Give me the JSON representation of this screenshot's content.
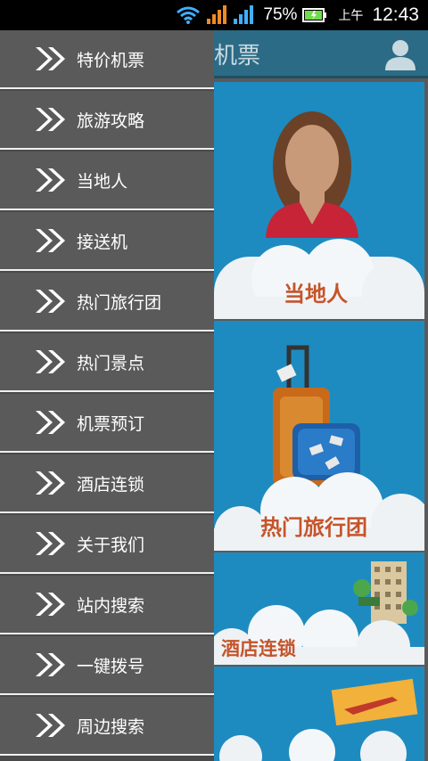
{
  "status_bar": {
    "battery_percent": "75%",
    "ampm": "上午",
    "time": "12:43",
    "icons": [
      "wifi-icon",
      "signal-icon",
      "signal-icon",
      "battery-icon"
    ]
  },
  "header": {
    "title": "机票",
    "user_icon": "user-icon"
  },
  "tiles": [
    {
      "label": "当地人",
      "image": "woman-avatar"
    },
    {
      "label": "热门旅行团",
      "image": "suitcases"
    },
    {
      "label": "酒店连锁",
      "image": "hotel"
    },
    {
      "label": "",
      "image": "airplane-ticket"
    }
  ],
  "drawer": {
    "items": [
      {
        "label": "特价机票"
      },
      {
        "label": "旅游攻略"
      },
      {
        "label": "当地人"
      },
      {
        "label": "接送机"
      },
      {
        "label": "热门旅行团"
      },
      {
        "label": "热门景点"
      },
      {
        "label": "机票预订"
      },
      {
        "label": "酒店连锁"
      },
      {
        "label": "关于我们"
      },
      {
        "label": "站内搜索"
      },
      {
        "label": "一键拨号"
      },
      {
        "label": "周边搜索"
      }
    ],
    "item_icon": "double-chevron-right-icon"
  },
  "colors": {
    "drawer_item_bg": "#5a5a5a",
    "header_bg": "#2b6b86",
    "tile_bg": "#1e8bc0",
    "tile_label": "#c5542a",
    "battery": "#6fdc4a",
    "signal": "#f08a24",
    "wifi": "#3fb0ff"
  }
}
